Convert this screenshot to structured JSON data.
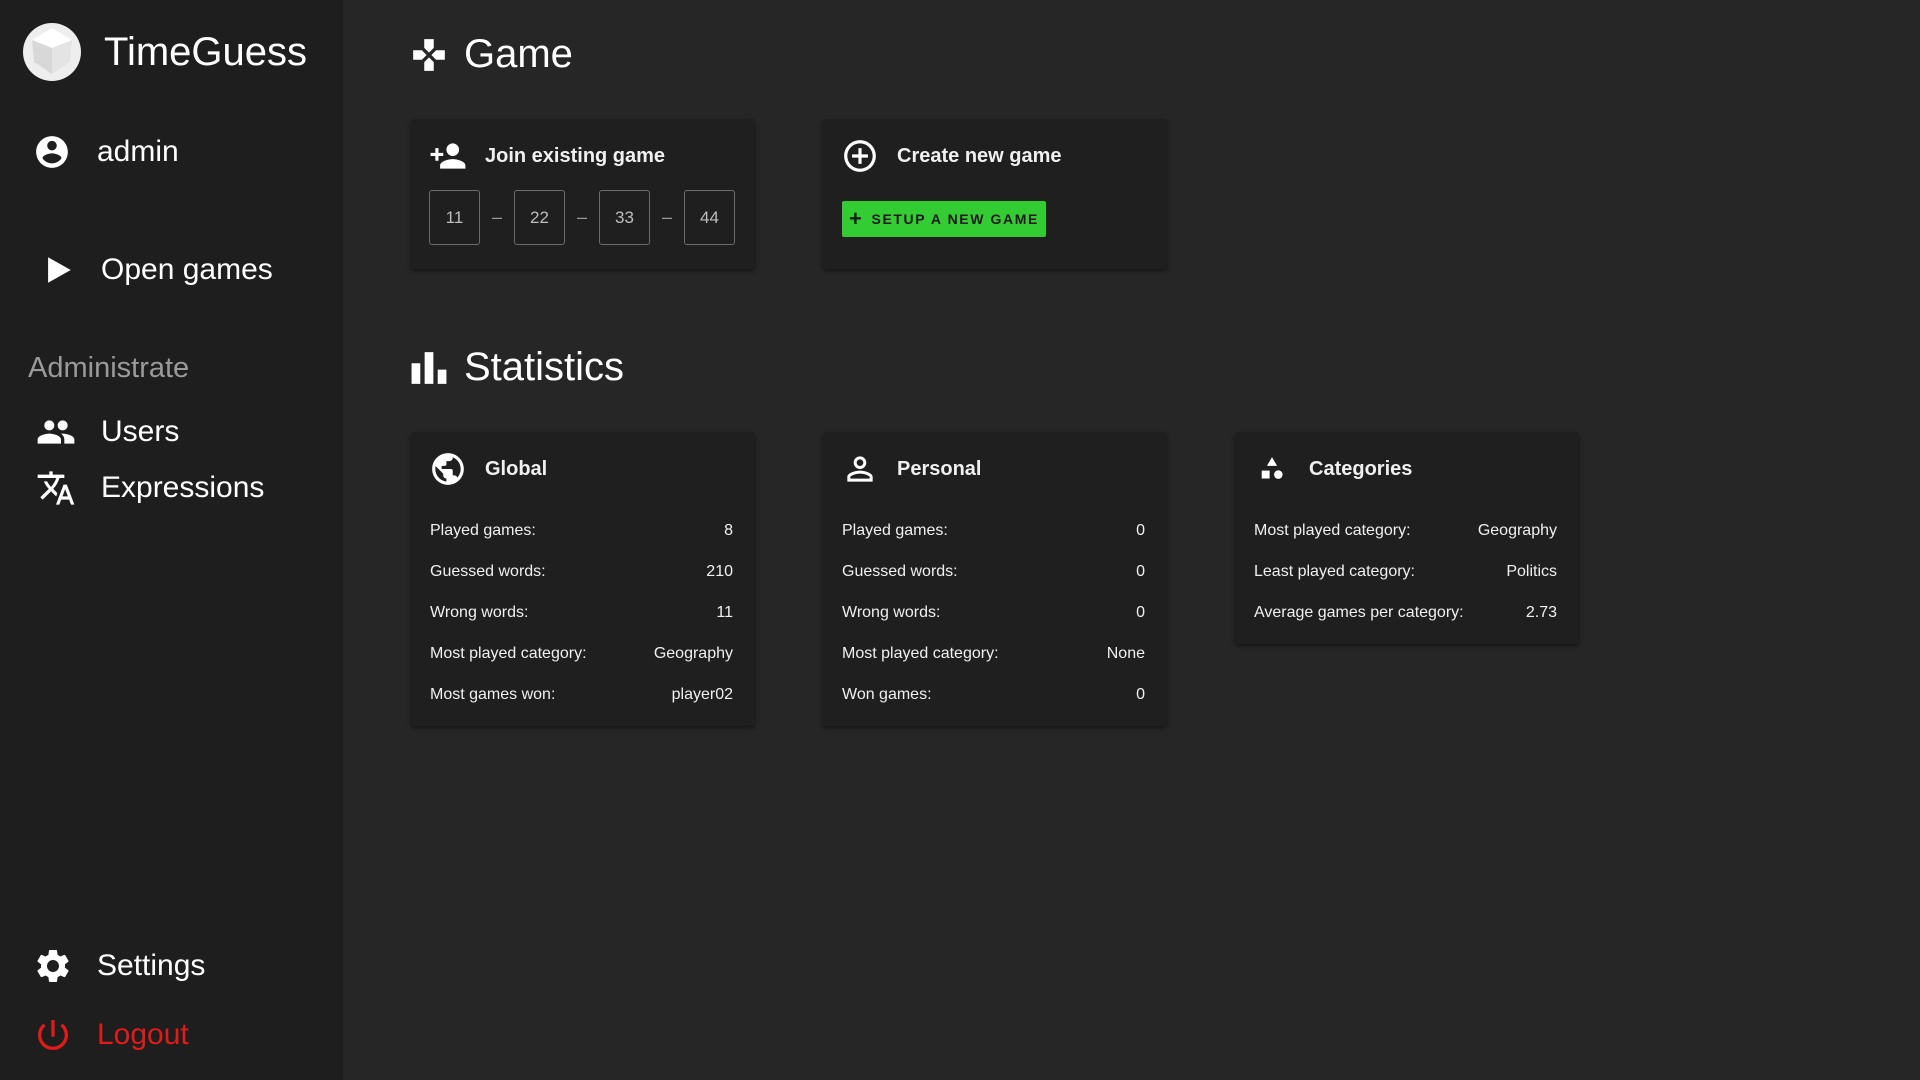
{
  "app": {
    "title": "TimeGuess"
  },
  "sidebar": {
    "user": {
      "label": "admin",
      "icon": "account-circle-icon"
    },
    "open_games": {
      "label": "Open games",
      "icon": "play-icon"
    },
    "section_label": "Administrate",
    "users": {
      "label": "Users",
      "icon": "people-icon"
    },
    "expressions": {
      "label": "Expressions",
      "icon": "translate-icon"
    },
    "settings": {
      "label": "Settings",
      "icon": "gear-icon"
    },
    "logout": {
      "label": "Logout",
      "icon": "power-icon",
      "color": "#e01b1b"
    }
  },
  "game_section": {
    "title": "Game",
    "join": {
      "title": "Join existing game",
      "codes": [
        "11",
        "22",
        "33",
        "44"
      ],
      "separator": "–"
    },
    "create": {
      "title": "Create new game",
      "button_label": "SETUP A NEW GAME",
      "button_color": "#33cc33"
    }
  },
  "stats_section": {
    "title": "Statistics",
    "global": {
      "title": "Global",
      "rows": [
        {
          "label": "Played games:",
          "value": "8"
        },
        {
          "label": "Guessed words:",
          "value": "210"
        },
        {
          "label": "Wrong words:",
          "value": "11"
        },
        {
          "label": "Most played category:",
          "value": "Geography"
        },
        {
          "label": "Most games won:",
          "value": "player02"
        }
      ]
    },
    "personal": {
      "title": "Personal",
      "rows": [
        {
          "label": "Played games:",
          "value": "0"
        },
        {
          "label": "Guessed words:",
          "value": "0"
        },
        {
          "label": "Wrong words:",
          "value": "0"
        },
        {
          "label": "Most played category:",
          "value": "None"
        },
        {
          "label": "Won games:",
          "value": "0"
        }
      ]
    },
    "categories": {
      "title": "Categories",
      "rows": [
        {
          "label": "Most played category:",
          "value": "Geography"
        },
        {
          "label": "Least played category:",
          "value": "Politics"
        },
        {
          "label": "Average games per category:",
          "value": "2.73"
        }
      ]
    }
  }
}
